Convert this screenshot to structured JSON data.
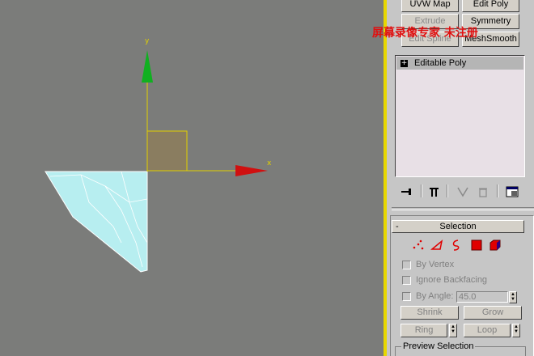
{
  "viewport": {
    "axis_x_label": "x",
    "axis_y_label": "y",
    "colors": {
      "background": "#7b7c7a",
      "axis": "#e0d000",
      "gizmo_x": "#d01010",
      "gizmo_y": "#10b020",
      "mesh": "#b7eef0"
    }
  },
  "watermark": {
    "text": "屏幕录像专家 未注册"
  },
  "modifier_buttons": [
    {
      "label": "UVW Map",
      "enabled": true
    },
    {
      "label": "Edit Poly",
      "enabled": true
    },
    {
      "label": "Extrude",
      "enabled": false
    },
    {
      "label": "Symmetry",
      "enabled": true
    },
    {
      "label": "Edit Spline",
      "enabled": false
    },
    {
      "label": "MeshSmooth",
      "enabled": true
    }
  ],
  "modifier_stack": {
    "items": [
      {
        "label": "Editable Poly",
        "expand_glyph": "+"
      }
    ]
  },
  "stack_toolbar": {
    "icons": [
      "pin-stack-icon",
      "show-end-result-icon",
      "make-unique-icon",
      "remove-modifier-icon",
      "configure-modifier-sets-icon"
    ]
  },
  "selection_rollout": {
    "collapse_glyph": "-",
    "title": "Selection",
    "subobject_icons": [
      "vertex-icon",
      "edge-icon",
      "border-icon",
      "polygon-icon",
      "element-icon"
    ],
    "by_vertex_label": "By Vertex",
    "ignore_backfacing_label": "Ignore Backfacing",
    "by_angle_label": "By Angle:",
    "by_angle_value": "45.0",
    "shrink_label": "Shrink",
    "grow_label": "Grow",
    "ring_label": "Ring",
    "loop_label": "Loop",
    "preview_selection_label": "Preview Selection"
  }
}
